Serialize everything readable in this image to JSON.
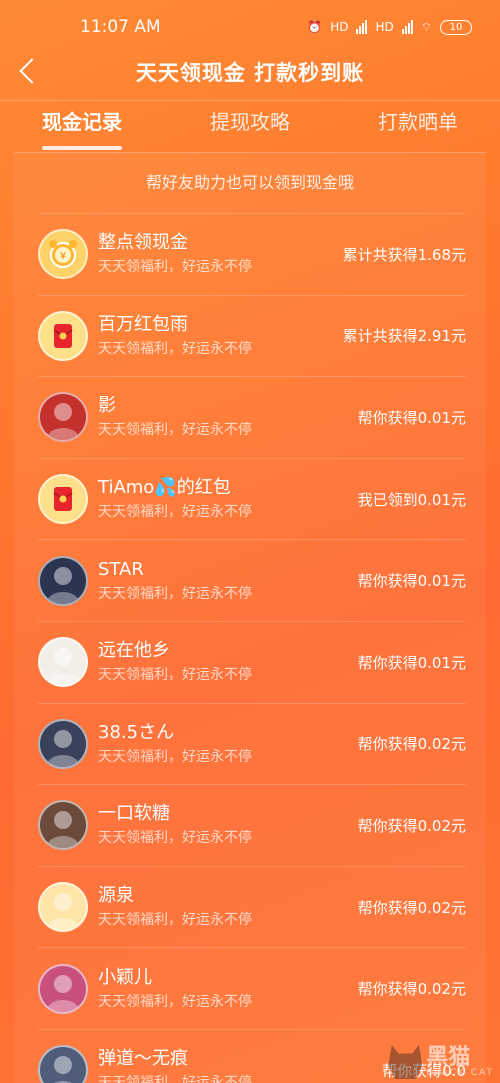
{
  "status_bar": {
    "time": "11:07 AM",
    "battery": "10",
    "hd1": "HD",
    "hd2": "HD"
  },
  "header": {
    "title": "天天领现金 打款秒到账"
  },
  "tabs": [
    {
      "label": "现金记录",
      "active": true
    },
    {
      "label": "提现攻略",
      "active": false
    },
    {
      "label": "打款晒单",
      "active": false
    }
  ],
  "hint": "帮好友助力也可以领到现金哦",
  "records": [
    {
      "name": "整点领现金",
      "sub": "天天领福利，好运永不停",
      "amount": "累计共获得1.68元",
      "avatar": "alarm-clock-icon",
      "bg": "#ffd36a"
    },
    {
      "name": "百万红包雨",
      "sub": "天天领福利，好运永不停",
      "amount": "累计共获得2.91元",
      "avatar": "red-envelope-icon",
      "bg": "#ffe08a"
    },
    {
      "name": "影",
      "sub": "天天领福利，好运永不停",
      "amount": "帮你获得0.01元",
      "avatar": "user-avatar",
      "bg": "#c4302b"
    },
    {
      "name": "TiAmo💦的红包",
      "sub": "天天领福利，好运永不停",
      "amount": "我已领到0.01元",
      "avatar": "red-envelope-icon",
      "bg": "#ffe08a"
    },
    {
      "name": "STAR",
      "sub": "天天领福利，好运永不停",
      "amount": "帮你获得0.01元",
      "avatar": "user-avatar",
      "bg": "#2b3550"
    },
    {
      "name": "远在他乡",
      "sub": "天天领福利，好运永不停",
      "amount": "帮你获得0.01元",
      "avatar": "user-avatar",
      "bg": "#f2efe9"
    },
    {
      "name": "38.5さん",
      "sub": "天天领福利，好运永不停",
      "amount": "帮你获得0.02元",
      "avatar": "user-avatar",
      "bg": "#39425a"
    },
    {
      "name": "一口软糖",
      "sub": "天天领福利，好运永不停",
      "amount": "帮你获得0.02元",
      "avatar": "user-avatar",
      "bg": "#6b4a3c"
    },
    {
      "name": "源泉",
      "sub": "天天领福利，好运永不停",
      "amount": "帮你获得0.02元",
      "avatar": "user-avatar",
      "bg": "#ffe6a8"
    },
    {
      "name": "小颖儿",
      "sub": "天天领福利，好运永不停",
      "amount": "帮你获得0.02元",
      "avatar": "user-avatar",
      "bg": "#c94f7c"
    },
    {
      "name": "弹道～无痕",
      "sub": "天天领福利，好运永不停",
      "amount": "帮你获得0.0",
      "avatar": "user-avatar",
      "bg": "#4f5d7a"
    }
  ],
  "watermark": {
    "cn": "黑猫",
    "en": "BLACK CAT"
  }
}
